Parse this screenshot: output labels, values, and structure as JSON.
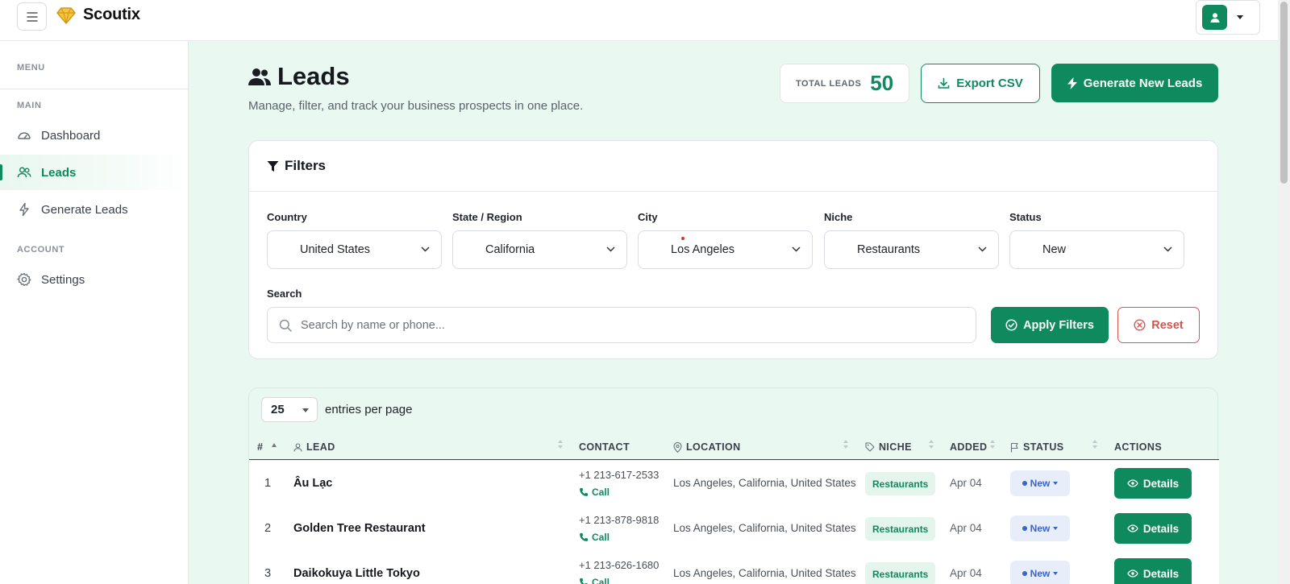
{
  "app": {
    "name": "Scoutix"
  },
  "sidebar": {
    "menu_label": "MENU",
    "main_label": "MAIN",
    "account_label": "ACCOUNT",
    "items": [
      {
        "label": "Dashboard",
        "icon": "dashboard-icon"
      },
      {
        "label": "Leads",
        "icon": "users-icon",
        "active": true
      },
      {
        "label": "Generate Leads",
        "icon": "bolt-icon"
      },
      {
        "label": "Settings",
        "icon": "gear-icon"
      }
    ]
  },
  "header": {
    "title": "Leads",
    "subtitle": "Manage, filter, and track your business prospects in one place.",
    "total_label": "TOTAL LEADS",
    "total_value": "50",
    "export_label": "Export CSV",
    "generate_label": "Generate New Leads"
  },
  "filters": {
    "title": "Filters",
    "country": {
      "label": "Country",
      "value": "United States"
    },
    "state": {
      "label": "State / Region",
      "value": "California"
    },
    "city": {
      "label": "City",
      "value": "Los Angeles"
    },
    "niche": {
      "label": "Niche",
      "value": "Restaurants"
    },
    "status": {
      "label": "Status",
      "value": "New"
    },
    "search": {
      "label": "Search",
      "placeholder": "Search by name or phone...",
      "value": ""
    },
    "apply_label": "Apply Filters",
    "reset_label": "Reset"
  },
  "table": {
    "page_size": "25",
    "page_size_label": "entries per page",
    "columns": {
      "num": "#",
      "lead": "LEAD",
      "contact": "CONTACT",
      "location": "LOCATION",
      "niche": "NICHE",
      "added": "ADDED",
      "status": "STATUS",
      "actions": "ACTIONS"
    },
    "call_label": "Call",
    "details_label": "Details",
    "rows": [
      {
        "num": "1",
        "lead": "Âu Lạc",
        "phone": "+1 213-617-2533",
        "location": "Los Angeles, California, United States",
        "niche": "Restaurants",
        "added": "Apr 04",
        "status": "New"
      },
      {
        "num": "2",
        "lead": "Golden Tree Restaurant",
        "phone": "+1 213-878-9818",
        "location": "Los Angeles, California, United States",
        "niche": "Restaurants",
        "added": "Apr 04",
        "status": "New"
      },
      {
        "num": "3",
        "lead": "Daikokuya Little Tokyo",
        "phone": "+1 213-626-1680",
        "location": "Los Angeles, California, United States",
        "niche": "Restaurants",
        "added": "Apr 04",
        "status": "New"
      }
    ]
  },
  "colors": {
    "accent": "#0f8a5f",
    "danger": "#d6554f",
    "status_new": "#3c64c8",
    "main_bg": "#e9f8f0"
  }
}
